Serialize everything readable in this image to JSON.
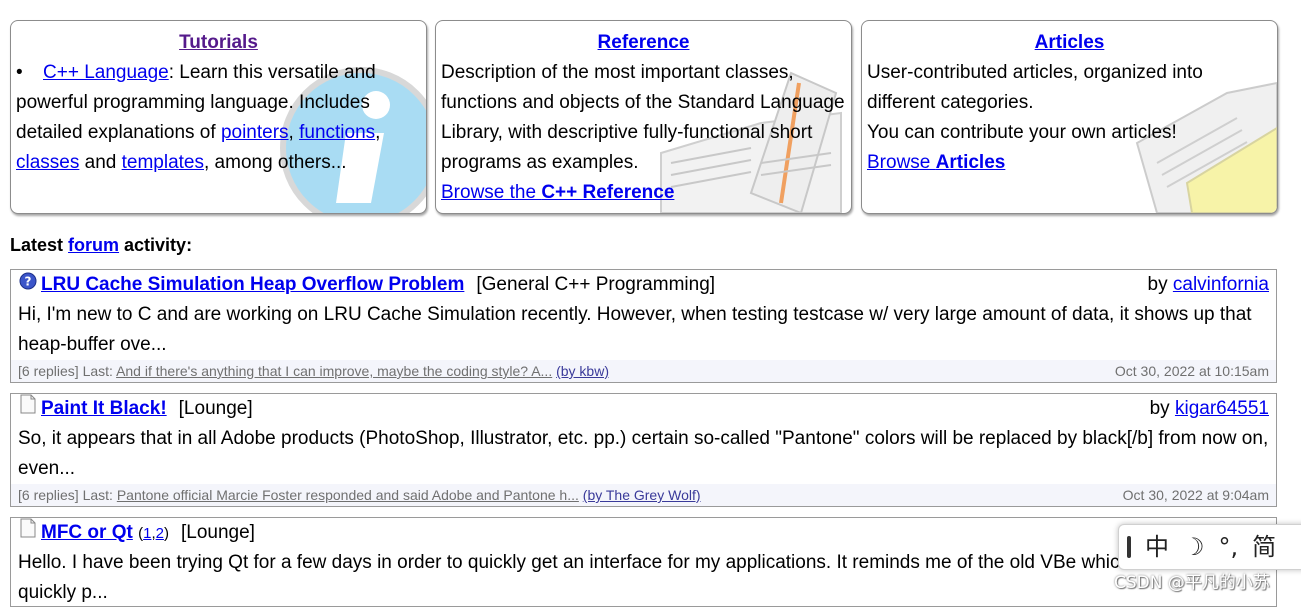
{
  "boxes": {
    "tutorials": {
      "title": "Tutorials",
      "bullet": "•",
      "lang_link": "C++ Language",
      "text1": ": Learn this versatile and powerful programming language. Includes detailed explanations of ",
      "pointers": "pointers",
      "comma1": ", ",
      "functions": "functions",
      "comma2": ", ",
      "classes": "classes",
      "and": " and ",
      "templates": "templates",
      "tail": ", among others..."
    },
    "reference": {
      "title": "Reference",
      "text": "Description of the most important classes, functions and objects of the Standard Language Library, with descriptive fully-functional short programs as examples.",
      "browse_prefix": "Browse the ",
      "browse_bold": "C++ Reference"
    },
    "articles": {
      "title": "Articles",
      "line1": "User-contributed articles, organized into different categories.",
      "line2": "You can contribute your own articles!",
      "browse_prefix": "Browse ",
      "browse_bold": "Articles"
    }
  },
  "latest": {
    "prefix": "Latest ",
    "link": "forum",
    "suffix": " activity:"
  },
  "topics": [
    {
      "icon": "question-icon",
      "title": "LRU Cache Simulation Heap Overflow Problem",
      "forum": "[General C++ Programming]",
      "by_label": "by ",
      "author": "calvinfornia",
      "body": "Hi, I'm new to C and are working on LRU Cache Simulation recently. However, when testing testcase w/ very large amount of data, it shows up that heap-buffer ove...",
      "replies": "[6 replies] Last: ",
      "last": "And if there's anything that I can improve, maybe the coding style? A...",
      "last_by": "(by kbw)",
      "when": "Oct 30, 2022 at 10:15am"
    },
    {
      "icon": "document-icon",
      "title": "Paint It Black!",
      "forum": "[Lounge]",
      "by_label": "by ",
      "author": "kigar64551",
      "body": "So, it appears that in all Adobe products (PhotoShop, Illustrator, etc. pp.) certain so-called \"Pantone\" colors will be replaced by black[/b] from now on, even...",
      "replies": "[6 replies] Last: ",
      "last": "Pantone official Marcie Foster responded and said Adobe and Pantone h...",
      "last_by": "(by The Grey Wolf)",
      "when": "Oct 30, 2022 at 9:04am"
    },
    {
      "icon": "document-icon",
      "title": "MFC or Qt",
      "pages_open": "(",
      "page1": "1",
      "pages_sep": ",",
      "page2": "2",
      "pages_close": ")",
      "forum": "[Lounge]",
      "body": "Hello. I have been trying Qt for a few days in order to quickly get an interface for my applications. It reminds me of the old VBe which allowed us to quickly p..."
    }
  ],
  "ime": {
    "grip": "|",
    "mode": "中",
    "moon": "☽",
    "punct": "°,",
    "simplified": "简"
  },
  "watermark": "CSDN @平凡的小苏"
}
